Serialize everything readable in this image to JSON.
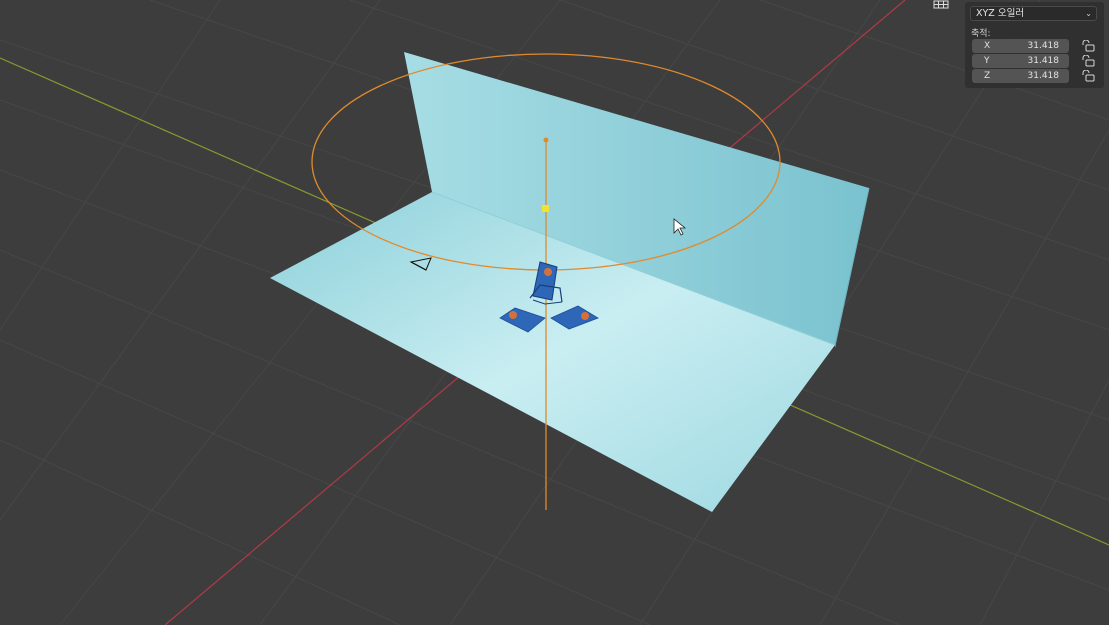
{
  "rotation_panel": {
    "mode_label": "XYZ 오일러",
    "axis_caption": "축적:",
    "axes": [
      {
        "name": "X",
        "value": "31.418"
      },
      {
        "name": "Y",
        "value": "31.418"
      },
      {
        "name": "Z",
        "value": "31.418"
      }
    ]
  },
  "icons": {
    "mode_dropdown": "chevron-down-icon",
    "lock": "padlock-unlocked-icon",
    "viewport_overlay": "grid-icon",
    "cursor": "mouse-pointer-icon"
  },
  "colors": {
    "viewport_background": "#3d3d3d",
    "grid_line": "#474747",
    "x_axis": "#b03a48",
    "y_axis": "#8a9a2f",
    "selection_outline": "#e08a2c",
    "backdrop_fill": "#a9dfe6",
    "card_blue": "#2e66b8"
  }
}
